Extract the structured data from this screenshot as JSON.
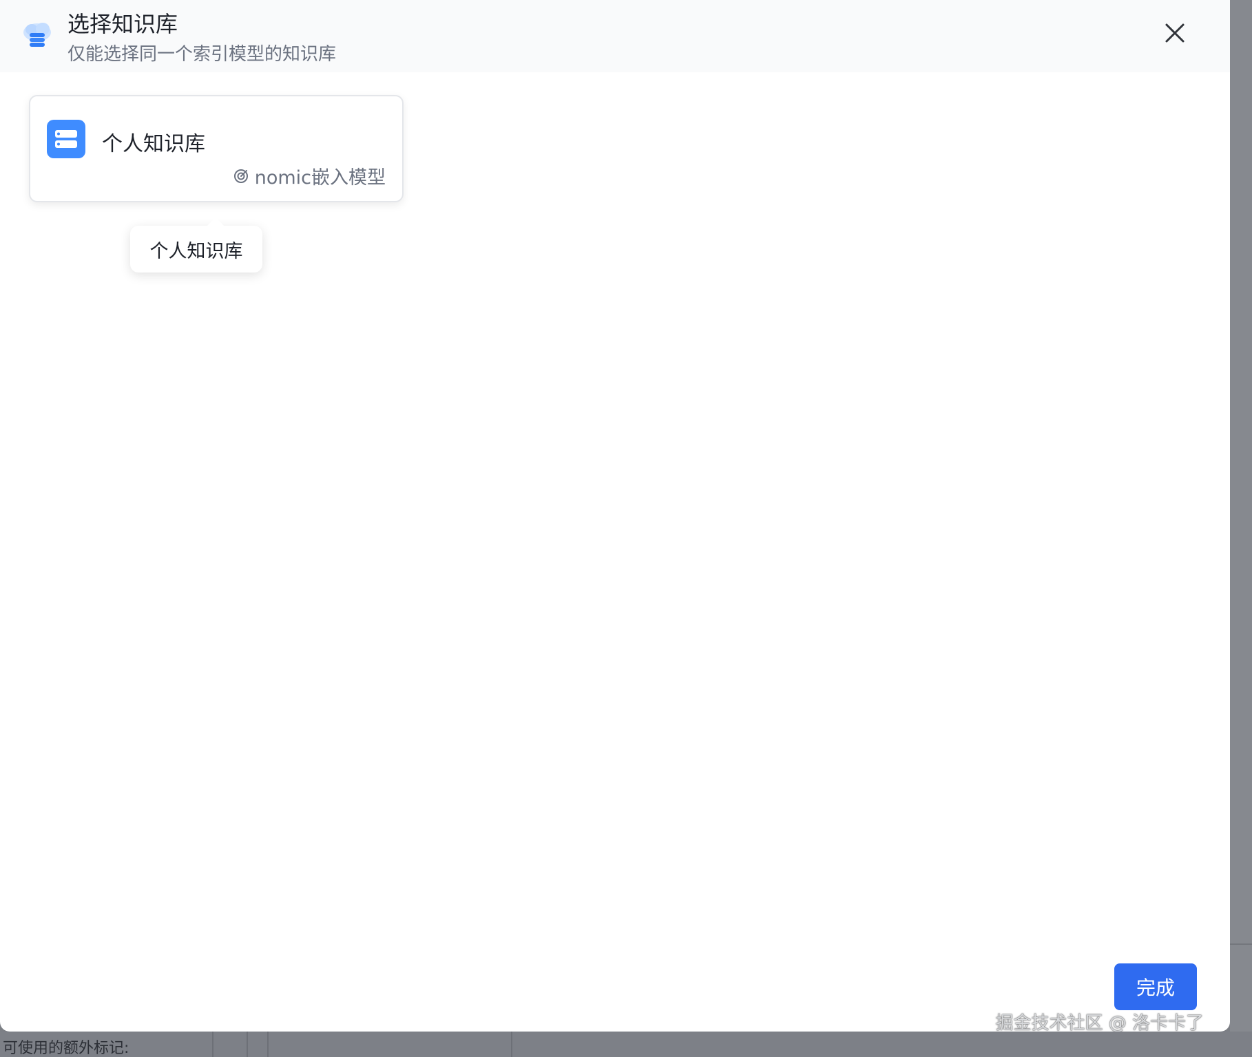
{
  "dialog": {
    "title": "选择知识库",
    "subtitle": "仅能选择同一个索引模型的知识库",
    "header_icon": "database-cloud-icon",
    "close_icon": "close-icon"
  },
  "knowledge_bases": [
    {
      "name": "个人知识库",
      "model": "nomic嵌入模型",
      "avatar_icon": "server-icon",
      "model_icon": "embedding-model-icon"
    }
  ],
  "tooltip": {
    "text": "个人知识库"
  },
  "footer": {
    "done_label": "完成"
  },
  "watermark": "掘金技术社区 @ 洛卡卡了",
  "background": {
    "partial_text": "可使用的额外标记:"
  },
  "colors": {
    "accent": "#2f6bf0",
    "avatar": "#3f8cff",
    "header_bg": "#f9fafb"
  }
}
